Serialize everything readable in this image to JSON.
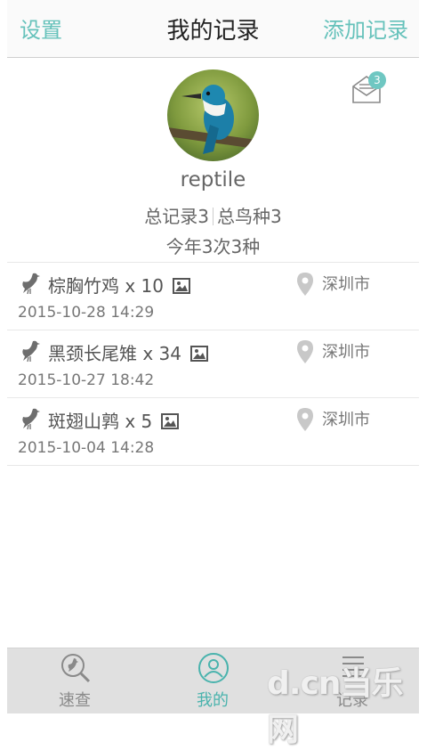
{
  "header": {
    "left_label": "设置",
    "title": "我的记录",
    "right_label": "添加记录"
  },
  "profile": {
    "username": "reptile",
    "total_records": "总记录3",
    "total_species": "总鸟种3",
    "this_year": "今年3次3种",
    "unread_messages": "3"
  },
  "records": [
    {
      "species": "棕胸竹鸡 x 10",
      "city": "深圳市",
      "time": "2015-10-28 14:29"
    },
    {
      "species": "黑颈长尾雉 x 34",
      "city": "深圳市",
      "time": "2015-10-27 18:42"
    },
    {
      "species": "斑翅山鹑 x 5",
      "city": "深圳市",
      "time": "2015-10-04 14:28"
    }
  ],
  "tabs": [
    {
      "label": "速查",
      "icon": "bird-search-icon"
    },
    {
      "label": "我的",
      "icon": "user-icon",
      "active": true
    },
    {
      "label": "记录",
      "icon": "list-icon"
    }
  ],
  "watermark": {
    "text": "d.cn当乐网"
  },
  "colors": {
    "accent": "#66c2bb",
    "tab_active": "#4ab3ad",
    "badge": "#6fc7c2"
  }
}
